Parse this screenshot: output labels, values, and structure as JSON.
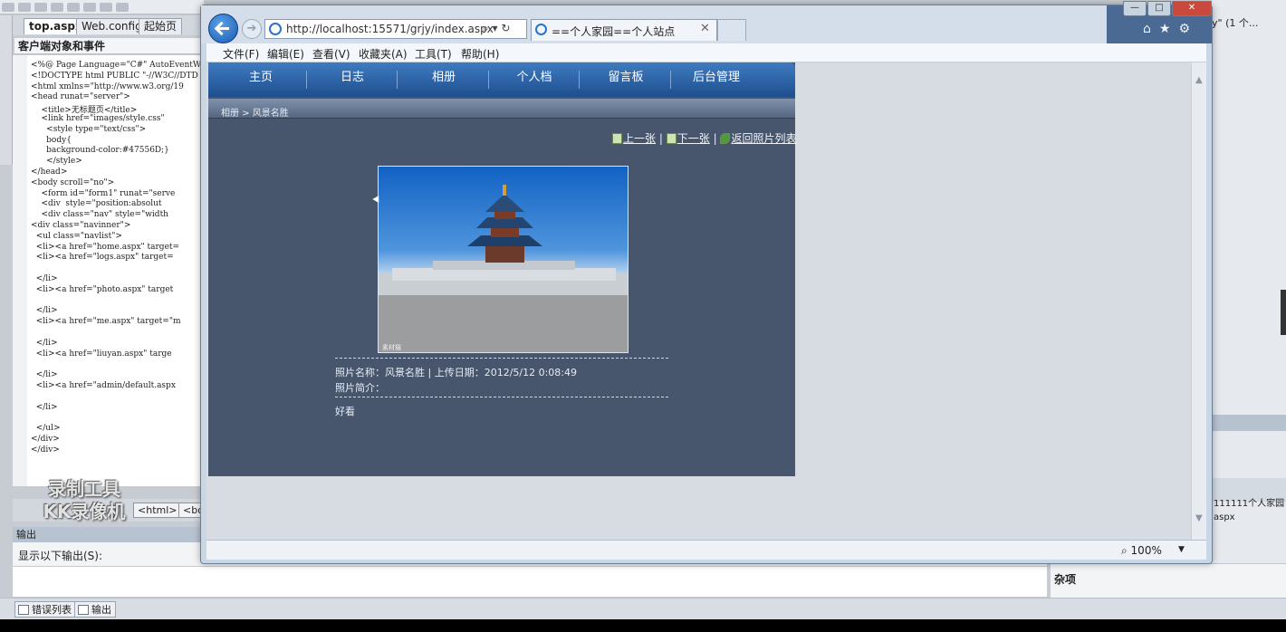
{
  "vs": {
    "tabs": [
      "top.aspx",
      "Web.config",
      "起始页"
    ],
    "dropdown": "客户端对象和事件",
    "code_lines": [
      "<%@ Page Language=\"C#\" AutoEventWi",
      "<!DOCTYPE html PUBLIC \"-//W3C//DTD",
      "<html xmlns=\"http://www.w3.org/19",
      "<head runat=\"server\">",
      "    <title>无标题页</title>",
      "    <link href=\"images/style.css\"",
      "      <style type=\"text/css\">",
      "      body{",
      "      background-color:#47556D;}",
      "      </style>",
      "</head>",
      "<body scroll=\"no\">",
      "    <form id=\"form1\" runat=\"serve",
      "    <div  style=\"position:absolut",
      "    <div class=\"nav\" style=\"width",
      "<div class=\"navinner\">",
      "  <ul class=\"navlist\">",
      "  <li><a href=\"home.aspx\" target=",
      "  <li><a href=\"logs.aspx\" target=",
      "",
      "  </li>",
      "  <li><a href=\"photo.aspx\" target",
      "",
      "  </li>",
      "  <li><a href=\"me.aspx\" target=\"m",
      "",
      "  </li>",
      "  <li><a href=\"liuyan.aspx\" targe",
      "",
      "  </li>",
      "  <li><a href=\"admin/default.aspx",
      "",
      "  </li>",
      "",
      "  </ul>",
      "</div>",
      "</div>"
    ],
    "tag_chips": [
      "<html>",
      "<bo"
    ],
    "watermark_line1": "录制工具",
    "watermark_line2": "KK录像机",
    "output_header": "输出",
    "output_label": "显示以下输出(S):",
    "footer_tabs": [
      "错误列表",
      "输出"
    ],
    "right_top": "y\" (1 个...",
    "right_text1": "111111个人家园",
    "right_text2": "aspx",
    "property_label": "杂项"
  },
  "browser": {
    "url": "http://localhost:15571/grjy/index.aspx",
    "tab_title": "==个人家园==个人站点",
    "menu": [
      "文件(F)",
      "编辑(E)",
      "查看(V)",
      "收藏夹(A)",
      "工具(T)",
      "帮助(H)"
    ],
    "zoom": "100%",
    "icons": [
      "back-icon",
      "forward-icon",
      "search-icon",
      "refresh-icon",
      "home-icon",
      "star-icon",
      "gear-icon"
    ]
  },
  "site": {
    "background": "#47566D",
    "nav": [
      "主页",
      "日志",
      "相册",
      "个人档",
      "留言板",
      "后台管理"
    ],
    "breadcrumb": "相册 > 风景名胜",
    "prev": "上一张",
    "next": "下一张",
    "back_to_list": "返回照片列表",
    "photo_caption": "素材猫",
    "photo_name_line": "照片名称：风景名胜   |   上传日期：2012/5/12 0:08:49",
    "photo_intro_label": "照片简介：",
    "photo_comment": "好看"
  }
}
